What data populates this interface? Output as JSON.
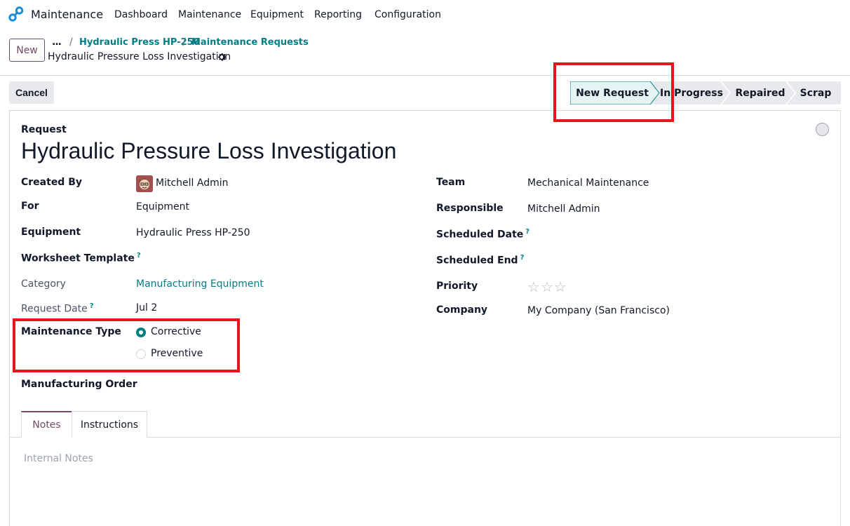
{
  "navbar": {
    "app_name": "Maintenance",
    "menu": [
      "Dashboard",
      "Maintenance",
      "Equipment",
      "Reporting",
      "Configuration"
    ]
  },
  "control_panel": {
    "new_button": "New",
    "breadcrumb_ellipsis": "...",
    "breadcrumbs": [
      "Hydraulic Press HP-250",
      "Maintenance Requests"
    ],
    "breadcrumb_separator": "/",
    "current_record": "Hydraulic Pressure Loss Investigation"
  },
  "actions": {
    "cancel": "Cancel"
  },
  "statusbar": {
    "stages": [
      "New Request",
      "In Progress",
      "Repaired",
      "Scrap"
    ],
    "active_stage": "New Request"
  },
  "form": {
    "request_label": "Request",
    "title": "Hydraulic Pressure Loss Investigation",
    "left": {
      "created_by_label": "Created By",
      "created_by_value": "Mitchell Admin",
      "for_label": "For",
      "for_value": "Equipment",
      "equipment_label": "Equipment",
      "equipment_value": "Hydraulic Press HP-250",
      "worksheet_label": "Worksheet Template",
      "category_label": "Category",
      "category_value": "Manufacturing Equipment",
      "request_date_label": "Request Date",
      "request_date_value": "Jul 2",
      "maintenance_type_label": "Maintenance Type",
      "maintenance_type_options": [
        "Corrective",
        "Preventive"
      ],
      "maintenance_type_selected": "Corrective",
      "manufacturing_order_label": "Manufacturing Order"
    },
    "right": {
      "team_label": "Team",
      "team_value": "Mechanical Maintenance",
      "responsible_label": "Responsible",
      "responsible_value": "Mitchell Admin",
      "scheduled_date_label": "Scheduled Date",
      "scheduled_end_label": "Scheduled End",
      "priority_label": "Priority",
      "priority_stars": 0,
      "priority_max": 3,
      "company_label": "Company",
      "company_value": "My Company (San Francisco)"
    },
    "tooltip_mark": "?",
    "tabs": [
      "Notes",
      "Instructions"
    ],
    "active_tab": "Notes",
    "notes_placeholder": "Internal Notes"
  },
  "colors": {
    "brand": "#714B67",
    "accent": "#017e84",
    "highlight": "#e8141b"
  },
  "icons": [
    "app-logo-icon",
    "gear-icon",
    "star-icon",
    "status-circle-icon"
  ]
}
